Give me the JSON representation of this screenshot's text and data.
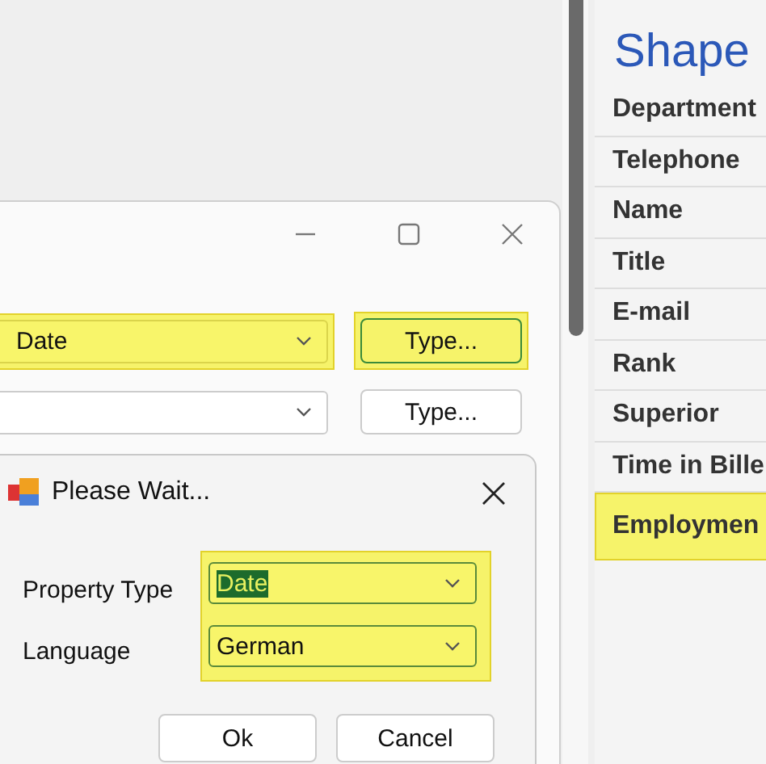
{
  "main_dialog": {
    "rows": [
      {
        "value": "Date",
        "highlighted": true,
        "button": {
          "label": "Type...",
          "highlighted": true
        }
      },
      {
        "highlighted": false,
        "button": {
          "label": "Type...",
          "highlighted": false
        }
      }
    ]
  },
  "wait_dialog": {
    "title": "Please Wait...",
    "highlighted": true,
    "fields": [
      {
        "label": "Property Type",
        "value": "Date",
        "text_selected": true
      },
      {
        "label": "Language",
        "value": "German",
        "text_selected": false
      }
    ],
    "buttons": [
      "Ok",
      "Cancel"
    ]
  },
  "shape_panel": {
    "title": "Shape",
    "rows": [
      {
        "label": "Department",
        "highlighted": false
      },
      {
        "label": "Telephone",
        "highlighted": false
      },
      {
        "label": "Name",
        "highlighted": false
      },
      {
        "label": "Title",
        "highlighted": false
      },
      {
        "label": "E-mail",
        "highlighted": false
      },
      {
        "label": "Rank",
        "highlighted": false
      },
      {
        "label": "Superior",
        "highlighted": false
      },
      {
        "label": "Time in Bille",
        "highlighted": false
      },
      {
        "label": "Employmen",
        "highlighted": true
      }
    ]
  }
}
